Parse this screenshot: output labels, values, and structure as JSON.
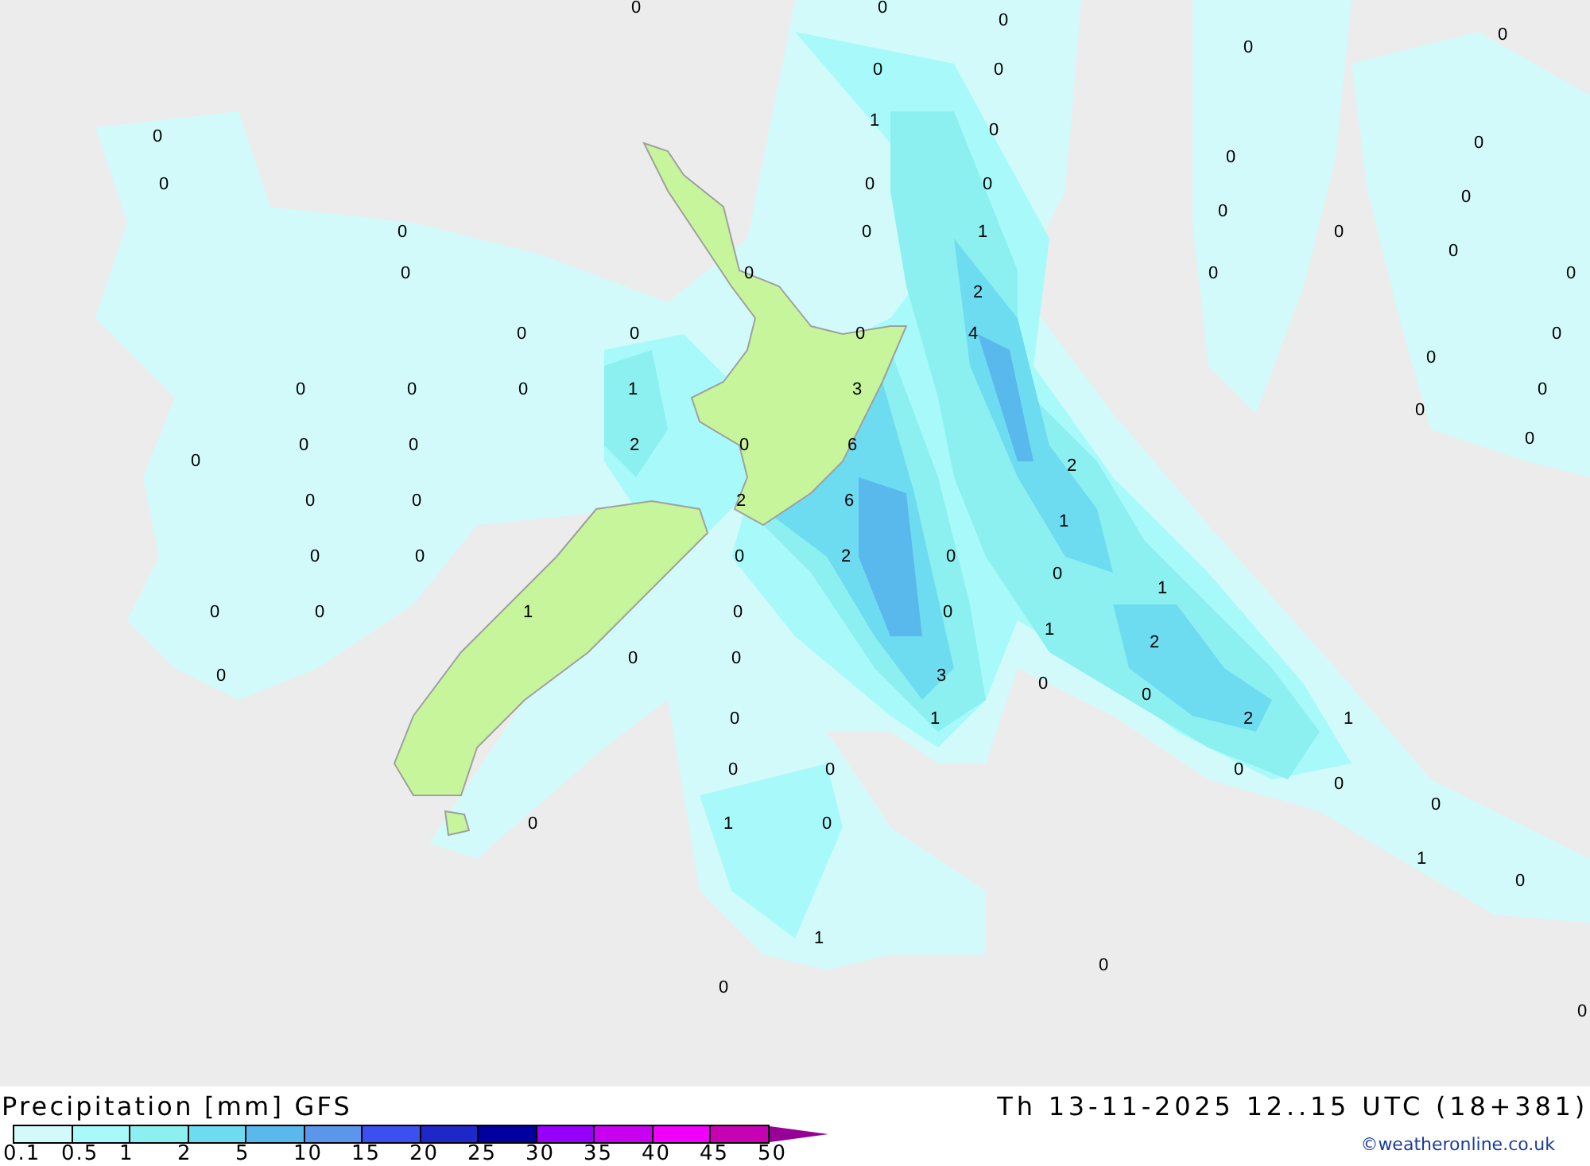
{
  "map": {
    "labels": [
      "0",
      "0",
      "0",
      "0",
      "0",
      "0",
      "0",
      "1",
      "0",
      "0",
      "0",
      "0",
      "0",
      "0",
      "0",
      "0",
      "0",
      "0",
      "0",
      "1",
      "0",
      "0",
      "0",
      "0",
      "0",
      "0",
      "2",
      "0",
      "0",
      "0",
      "4",
      "0",
      "0",
      "0",
      "0",
      "0",
      "1",
      "3",
      "0",
      "0",
      "0",
      "0",
      "2",
      "0",
      "6",
      "0",
      "0",
      "2",
      "0",
      "0",
      "2",
      "6",
      "1",
      "0",
      "0",
      "0",
      "2",
      "0",
      "0",
      "1",
      "0",
      "0",
      "1",
      "0",
      "0",
      "1",
      "2",
      "0",
      "0",
      "0",
      "3",
      "0",
      "0",
      "0",
      "1",
      "2",
      "1",
      "0",
      "0",
      "0",
      "0",
      "0",
      "0",
      "1",
      "0",
      "1",
      "0",
      "1",
      "0",
      "0",
      "0"
    ]
  },
  "legend": {
    "title": "Precipitation [mm] GFS",
    "valid_time": "Th 13-11-2025 12..15 UTC (18+381)",
    "credit": "©weatheronline.co.uk",
    "scale": [
      {
        "label": "0.1",
        "color": "#d2fafa"
      },
      {
        "label": "0.5",
        "color": "#a8fafa"
      },
      {
        "label": "1",
        "color": "#8cf0f0"
      },
      {
        "label": "2",
        "color": "#6edcf0"
      },
      {
        "label": "5",
        "color": "#5ab9ec"
      },
      {
        "label": "10",
        "color": "#5a96ec"
      },
      {
        "label": "15",
        "color": "#3c50f0"
      },
      {
        "label": "20",
        "color": "#1e28c8"
      },
      {
        "label": "25",
        "color": "#0000a0"
      },
      {
        "label": "30",
        "color": "#9600fa"
      },
      {
        "label": "35",
        "color": "#c800f0"
      },
      {
        "label": "40",
        "color": "#f000fa"
      },
      {
        "label": "45",
        "color": "#c800b4"
      },
      {
        "label": "50",
        "color": "#960096"
      }
    ]
  }
}
